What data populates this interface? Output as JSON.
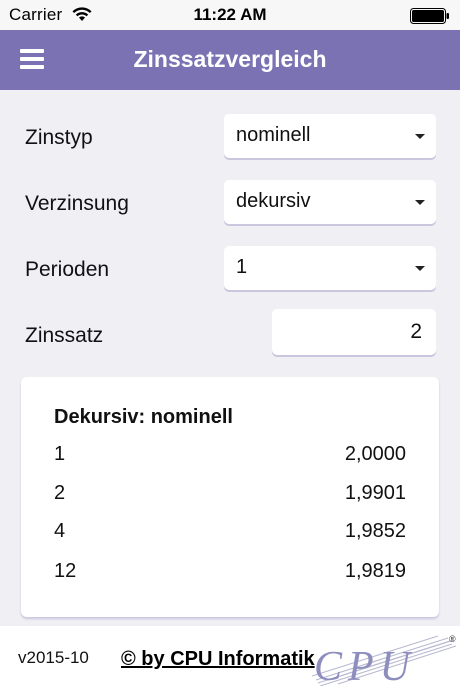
{
  "status_bar": {
    "carrier": "Carrier",
    "time": "11:22 AM",
    "icons": [
      "wifi-icon",
      "battery-icon"
    ]
  },
  "nav": {
    "title": "Zinssatzvergleich",
    "menu_icon": "hamburger-menu-icon",
    "color": "#7b72b3"
  },
  "form": {
    "zinstyp": {
      "label": "Zinstyp",
      "value": "nominell"
    },
    "verzinsung": {
      "label": "Verzinsung",
      "value": "dekursiv"
    },
    "perioden": {
      "label": "Perioden",
      "value": "1"
    },
    "zinssatz": {
      "label": "Zinssatz",
      "value": "2"
    }
  },
  "results": {
    "title": "Dekursiv: nominell",
    "rows": [
      {
        "period": "1",
        "rate": "2,0000"
      },
      {
        "period": "2",
        "rate": "1,9901"
      },
      {
        "period": "4",
        "rate": "1,9852"
      },
      {
        "period": "12",
        "rate": "1,9819"
      }
    ]
  },
  "footer": {
    "version": "v2015-10",
    "copyright": "© by CPU Informatik",
    "logo_text": "CPU",
    "logo_mark": "®"
  }
}
